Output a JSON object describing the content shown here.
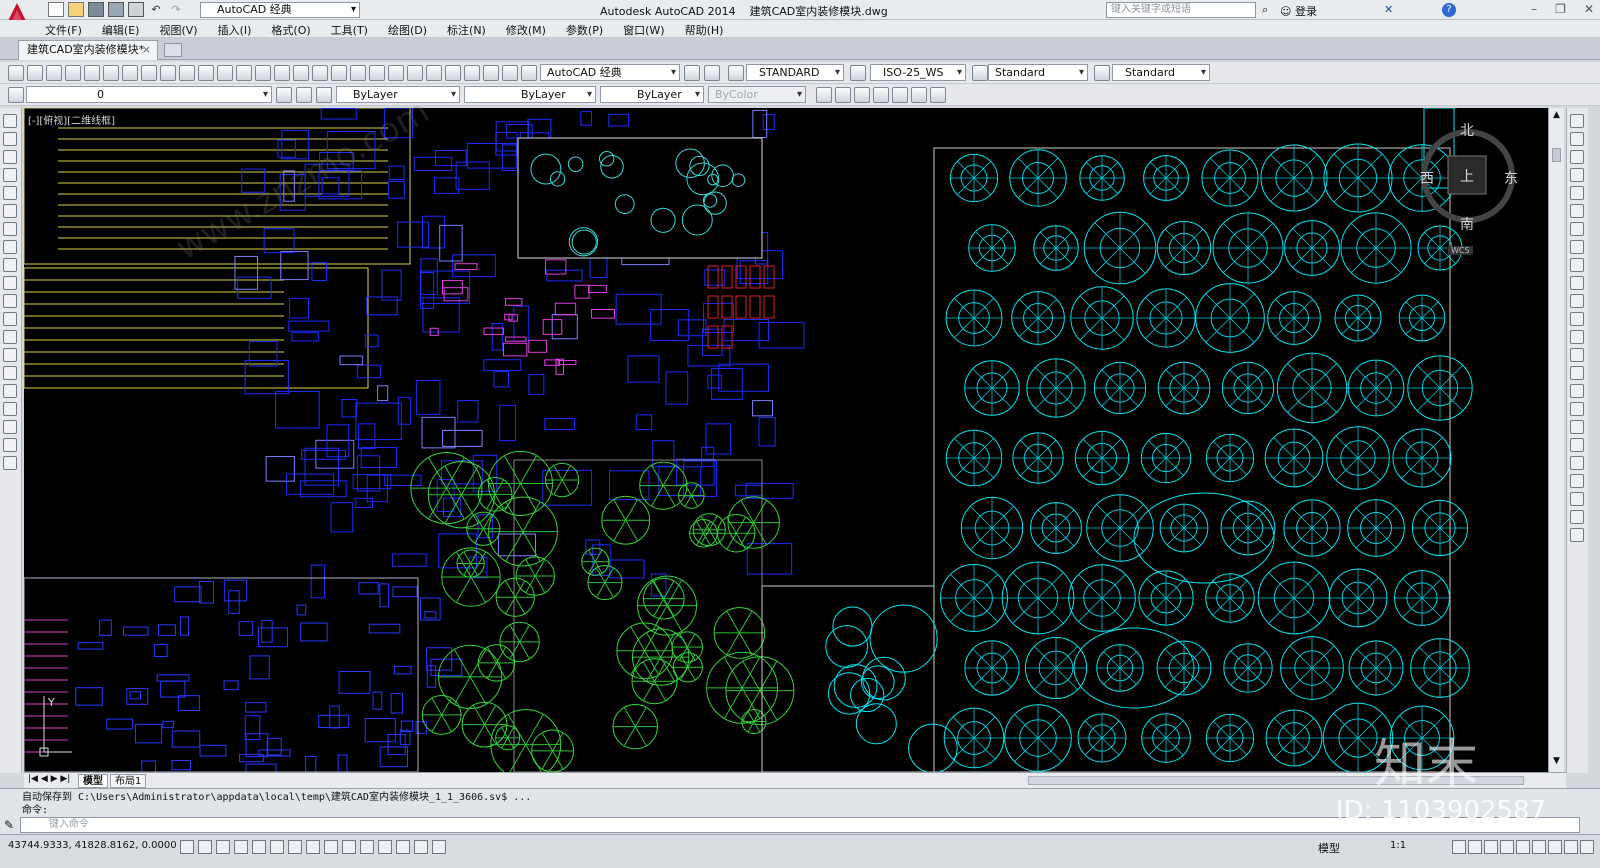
{
  "app": {
    "title": "Autodesk AutoCAD 2014",
    "filename": "建筑CAD室内装修模块.dwg",
    "workspace": "AutoCAD 经典",
    "search_placeholder": "键入关键字或短语",
    "login_label": "登录"
  },
  "menu": [
    "文件(F)",
    "编辑(E)",
    "视图(V)",
    "插入(I)",
    "格式(O)",
    "工具(T)",
    "绘图(D)",
    "标注(N)",
    "修改(M)",
    "参数(P)",
    "窗口(W)",
    "帮助(H)"
  ],
  "doc_tab": {
    "label": "建筑CAD室内装修模块*",
    "close": "×"
  },
  "toolbar1": {
    "workspace_select": "AutoCAD 经典",
    "text_style": "STANDARD",
    "dim_style": "ISO-25_WS",
    "table_style": "Standard",
    "mleader_style": "Standard"
  },
  "toolbar2": {
    "layer": "0",
    "color": "ByLayer",
    "linetype": "ByLayer",
    "lineweight": "ByLayer",
    "plotstyle": "ByColor"
  },
  "canvas": {
    "view_label": "[-][俯视][二维线框]",
    "viewcube": {
      "north": "北",
      "south": "南",
      "east": "东",
      "west": "西",
      "top": "上",
      "wcs": "WCS"
    }
  },
  "layout_tabs": [
    "模型",
    "布局1"
  ],
  "command": {
    "history_line1": "自动保存到 C:\\Users\\Administrator\\appdata\\local\\temp\\建筑CAD室内装修模块_1_1_3606.sv$ ...",
    "history_line2": "命令:",
    "input_placeholder": "键入命令"
  },
  "status": {
    "coordinates": "43744.9333, 41828.8162, 0.0000",
    "model_label": "模型",
    "annotation_scale": "1:1"
  },
  "watermark": {
    "brand": "知末",
    "id": "ID: 1103902587",
    "site": "www.znzmo.com"
  }
}
